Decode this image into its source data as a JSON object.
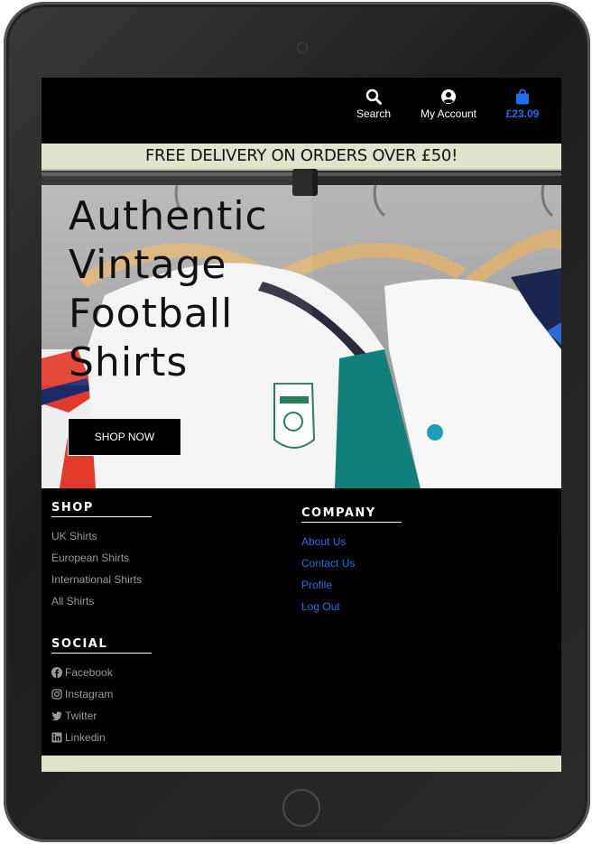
{
  "header": {
    "search_label": "Search",
    "account_label": "My Account",
    "bag_total": "£23.09"
  },
  "banner": {
    "delivery_text": "FREE DELIVERY ON ORDERS OVER £50!"
  },
  "hero": {
    "title_lines": [
      "Authentic",
      "Vintage",
      "Football",
      "Shirts"
    ],
    "cta_label": "SHOP NOW"
  },
  "footer": {
    "shop": {
      "title": "SHOP",
      "links": [
        "UK Shirts",
        "European Shirts",
        "International Shirts",
        "All Shirts"
      ]
    },
    "company": {
      "title": "COMPANY",
      "links": [
        "About Us",
        "Contact Us",
        "Profile",
        "Log Out"
      ]
    },
    "social": {
      "title": "SOCIAL",
      "links": [
        {
          "label": "Facebook",
          "icon": "facebook-icon"
        },
        {
          "label": "Instagram",
          "icon": "instagram-icon"
        },
        {
          "label": "Twitter",
          "icon": "twitter-icon"
        },
        {
          "label": "Linkedin",
          "icon": "linkedin-icon"
        }
      ]
    }
  },
  "colors": {
    "accent_blue": "#1f6fe8",
    "banner_bg": "#e1e3cb",
    "page_bg": "#000000"
  }
}
